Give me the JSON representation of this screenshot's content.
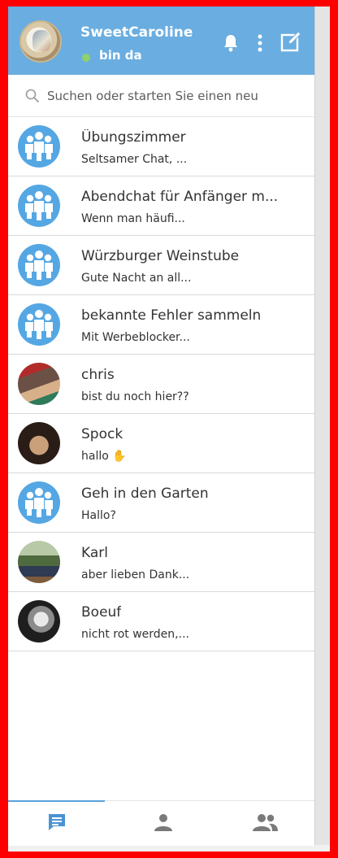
{
  "header": {
    "user_name": "SweetCaroline",
    "status": "bin da",
    "status_color": "#8fd16a",
    "background": "#6aade0",
    "icons": [
      "bell-icon",
      "more-vertical-icon",
      "compose-icon"
    ]
  },
  "search": {
    "placeholder": "Suchen oder starten Sie einen neu"
  },
  "chats": [
    {
      "name": "Übungszimmer",
      "preview": "Seltsamer Chat, ...",
      "avatar": "group"
    },
    {
      "name": "Abendchat für Anfänger m...",
      "preview": "Wenn man häufi...",
      "avatar": "group"
    },
    {
      "name": "Würzburger Weinstube",
      "preview": "Gute Nacht an all...",
      "avatar": "group"
    },
    {
      "name": "bekannte Fehler sammeln",
      "preview": "Mit Werbeblocker...",
      "avatar": "group"
    },
    {
      "name": "chris",
      "preview": "bist du noch hier??",
      "avatar": "photo"
    },
    {
      "name": "Spock",
      "preview": "hallo ✋",
      "avatar": "photo"
    },
    {
      "name": "Geh in den Garten",
      "preview": "Hallo?",
      "avatar": "group"
    },
    {
      "name": "Karl",
      "preview": "aber lieben Dank...",
      "avatar": "photo"
    },
    {
      "name": "Boeuf",
      "preview": "nicht rot werden,...",
      "avatar": "photo"
    }
  ],
  "bottom_nav": {
    "tabs": [
      "chat-icon",
      "person-icon",
      "group-icon"
    ],
    "active": "chat-icon",
    "accent": "#4a93d3"
  }
}
